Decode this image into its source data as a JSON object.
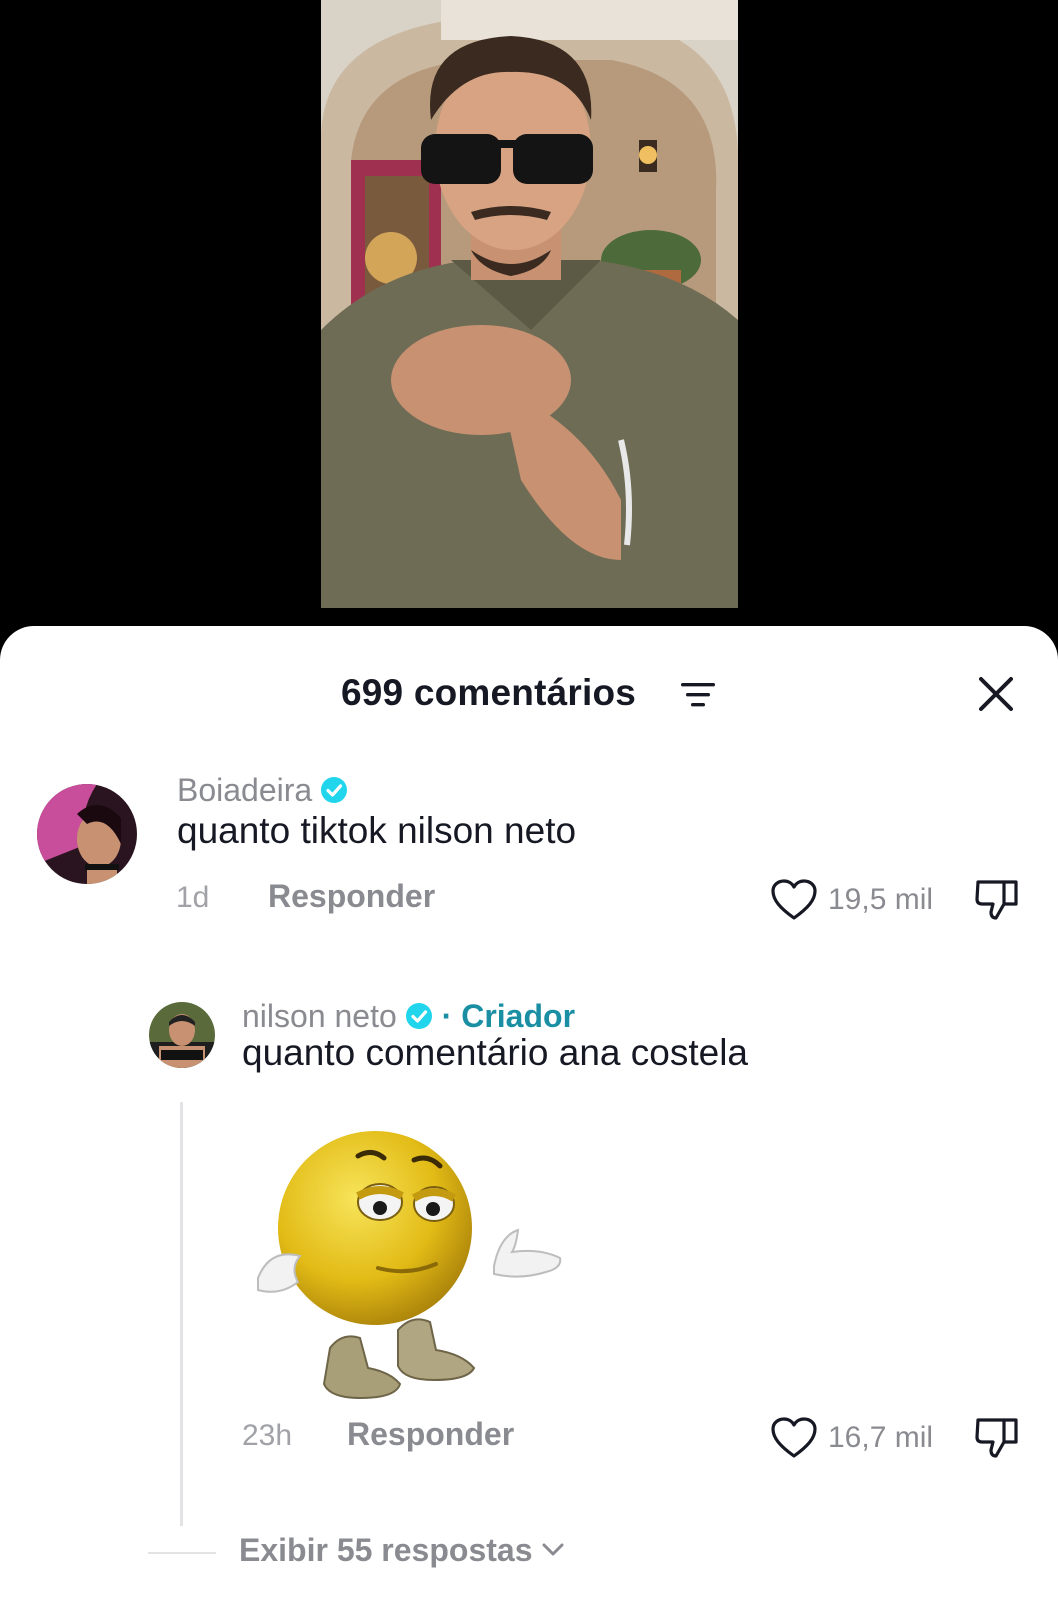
{
  "header": {
    "comment_count_label": "699 comentários"
  },
  "icons": {
    "filter": "filter-icon",
    "close": "close-icon",
    "verified": "verified-badge-icon",
    "like": "heart-icon",
    "dislike": "thumbs-down-icon",
    "expand": "chevron-down-icon"
  },
  "colors": {
    "verified": "#20d5ec",
    "creator": "#1a8fa3",
    "muted_text": "#8a8b91",
    "primary_text": "#161823"
  },
  "comments": [
    {
      "username": "Boiadeira",
      "verified": true,
      "text": "quanto tiktok nilson neto",
      "time": "1d",
      "reply_label": "Responder",
      "likes": "19,5 mil"
    },
    {
      "username": "nilson neto",
      "verified": true,
      "creator_label": "· Criador",
      "text": "quanto comentário ana costela",
      "time": "23h",
      "reply_label": "Responder",
      "likes": "16,7 mil"
    }
  ],
  "replies": {
    "view_label": "Exibir 55 respostas"
  }
}
